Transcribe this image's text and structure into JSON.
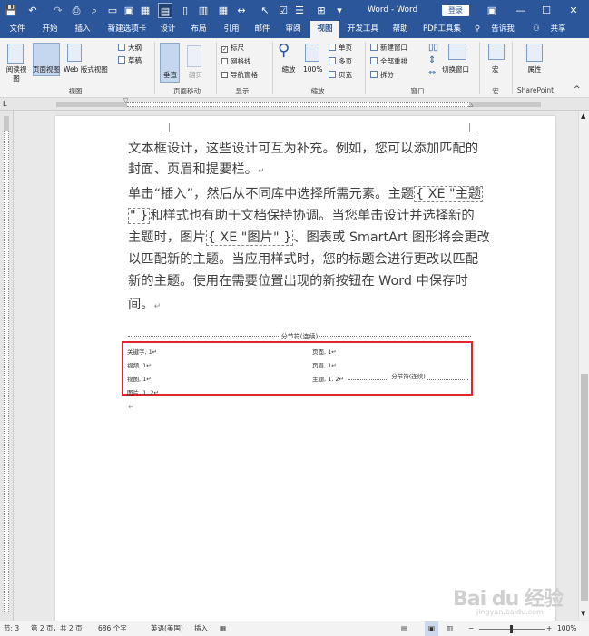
{
  "app": {
    "title": "Word - Word",
    "login": "登录",
    "share": "共享",
    "tell_me": "告诉我"
  },
  "tabs": [
    "文件",
    "开始",
    "插入",
    "新建选项卡",
    "设计",
    "布局",
    "引用",
    "邮件",
    "审阅",
    "视图",
    "开发工具",
    "帮助",
    "PDF工具集"
  ],
  "active_tab": "视图",
  "ribbon": {
    "views": {
      "read": "阅读视图",
      "print": "页面视图",
      "web": "Web 版式视图",
      "outline": "大纲",
      "draft": "草稿",
      "group": "视图"
    },
    "page_move": {
      "vertical": "垂直",
      "side": "翻页",
      "group": "页面移动"
    },
    "show": {
      "ruler": "标尺",
      "gridlines": "网格线",
      "nav": "导航窗格",
      "group": "显示",
      "ruler_checked": true
    },
    "zoom": {
      "zoom": "缩放",
      "percent": "100%",
      "one": "单页",
      "multi": "多页",
      "width": "页宽",
      "group": "缩放"
    },
    "window": {
      "new": "新建窗口",
      "arrange": "全部重排",
      "split": "拆分",
      "switch": "切换窗口",
      "group": "窗口"
    },
    "macro": {
      "label": "宏",
      "group": "宏"
    },
    "sharepoint": {
      "label": "属性",
      "group": "SharePoint"
    }
  },
  "document": {
    "line1": "文本框设计，这些设计可互为补充。例如，您可以添加匹配的",
    "line2": "封面、页眉和提要栏。",
    "line3a": "单击“插入”，然后从不同库中选择所需元素。主题",
    "field1": "{ XE \"主题",
    "field1b": "\" }",
    "line4": "和样式也有助于文档保持协调。当您单击设计并选择新的",
    "line5a": "主题时，图片",
    "field2": "{ XE \"图片\" }",
    "line5b": "、图表或 SmartArt 图形将会更改",
    "line6": "以匹配新的主题。当应用样式时，您的标题会进行更改以匹配",
    "line7": "新的主题。使用在需要位置出现的新按钮在 Word 中保存时",
    "line8": "间。",
    "section_break": "分节符(连续)",
    "index_left": [
      "关键字, 1↵",
      "视频, 1↵",
      "视图, 1↵",
      "图片, 1, 2↵"
    ],
    "index_right": [
      "页面, 1↵",
      "页眉, 1↵",
      "主题, 1, 2↵"
    ],
    "index_section_break": "分节符(连续)"
  },
  "status": {
    "section": "节: 3",
    "page": "第 2 页，共 2 页",
    "words": "686 个字",
    "lang": "英语(美国)",
    "mode": "插入",
    "zoom": "100%"
  },
  "watermark": {
    "text": "Bai du 经验",
    "sub": "jingyan.baidu.com"
  }
}
